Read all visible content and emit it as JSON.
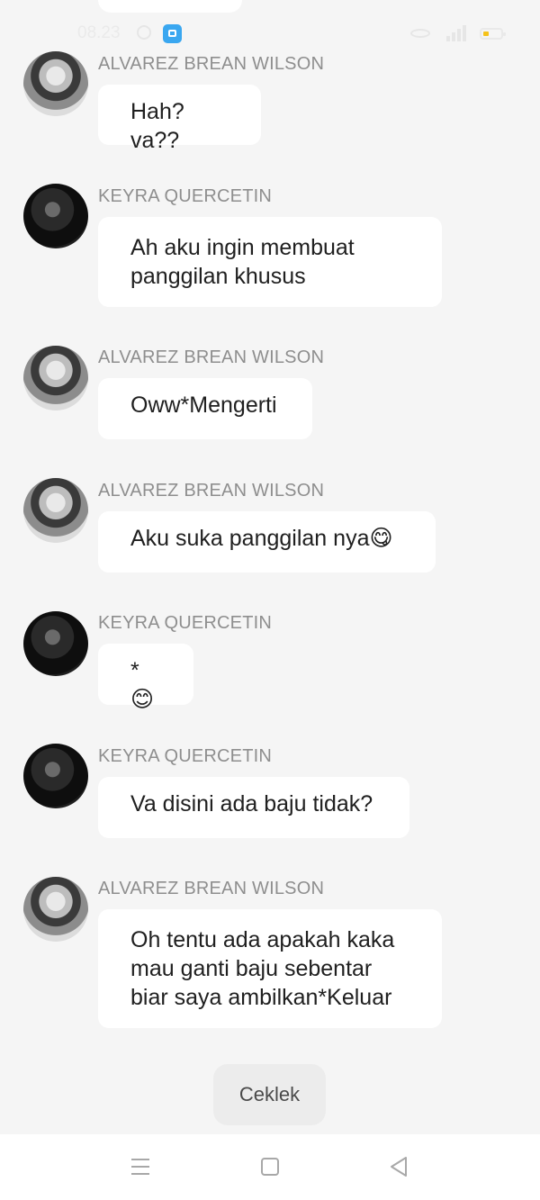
{
  "status_bar": {
    "time": "08.23"
  },
  "messages": [
    {
      "sender": "ALVAREZ BREAN WILSON",
      "avatar": "alvarez",
      "lines": [
        "Hah? va??"
      ]
    },
    {
      "sender": "KEYRA QUERCETIN",
      "avatar": "keyra",
      "lines": [
        "Ah aku ingin membuat",
        "panggilan khusus"
      ]
    },
    {
      "sender": "ALVAREZ BREAN WILSON",
      "avatar": "alvarez",
      "lines": [
        "Oww*Mengerti"
      ]
    },
    {
      "sender": "ALVAREZ BREAN WILSON",
      "avatar": "alvarez",
      "lines": [
        "Aku suka panggilan nya😋"
      ]
    },
    {
      "sender": "KEYRA QUERCETIN",
      "avatar": "keyra",
      "lines": [
        "*😊"
      ]
    },
    {
      "sender": "KEYRA QUERCETIN",
      "avatar": "keyra",
      "lines": [
        "Va disini ada baju tidak?"
      ]
    },
    {
      "sender": "ALVAREZ BREAN WILSON",
      "avatar": "alvarez",
      "lines": [
        "Oh tentu ada apakah kaka",
        "mau ganti baju sebentar",
        "biar saya ambilkan*Keluar"
      ]
    }
  ],
  "action_button": {
    "label": "Ceklek"
  },
  "nav_bar": {
    "icons": [
      "menu-icon",
      "home-icon",
      "back-icon"
    ]
  }
}
